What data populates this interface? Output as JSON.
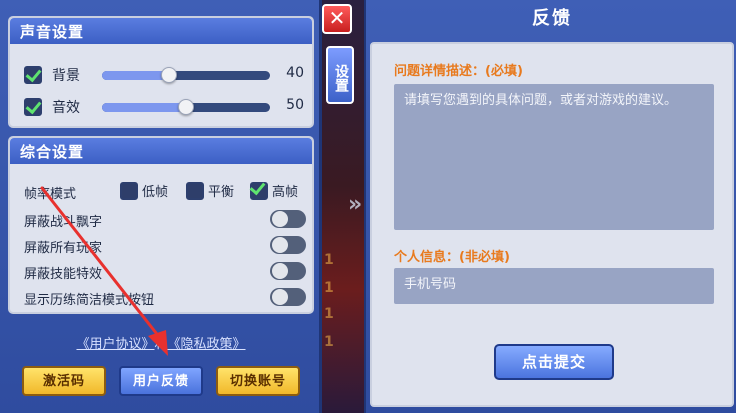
{
  "sound_settings": {
    "title": "声音设置",
    "items": [
      {
        "label": "背景",
        "value": "40",
        "level": 0.4,
        "checked": true
      },
      {
        "label": "音效",
        "value": "50",
        "level": 0.5,
        "checked": true
      }
    ]
  },
  "general_settings": {
    "title": "综合设置",
    "frame_rate": {
      "label": "帧率模式",
      "options": [
        {
          "label": "低帧",
          "checked": false
        },
        {
          "label": "平衡",
          "checked": false
        },
        {
          "label": "高帧",
          "checked": true
        }
      ]
    },
    "toggles": [
      {
        "label": "屏蔽战斗飘字",
        "on": false
      },
      {
        "label": "屏蔽所有玩家",
        "on": false
      },
      {
        "label": "屏蔽技能特效",
        "on": false
      },
      {
        "label": "显示历练简洁模式按钮",
        "on": false
      }
    ]
  },
  "links": {
    "user_agreement": "《用户协议》",
    "and": "和",
    "privacy_policy": "《隐私政策》"
  },
  "buttons": {
    "activation_code": "激活码",
    "user_feedback": "用户反馈",
    "switch_account": "切换账号"
  },
  "side": {
    "close": "✕",
    "settings_tab": "设置"
  },
  "scene_numbers": [
    "1",
    "1",
    "1",
    "1"
  ],
  "feedback": {
    "title": "反馈",
    "problem_label": "问题详情描述：(必填)",
    "problem_placeholder": "请填写您遇到的具体问题，或者对游戏的建议。",
    "personal_label": "个人信息：(非必填)",
    "phone_placeholder": "手机号码",
    "submit": "点击提交"
  },
  "colors": {
    "panel_blue": "#3f5fb6",
    "label_orange": "#e87a1e",
    "button_yellow": "#f1b82a",
    "annotation_red": "#e8312e"
  }
}
